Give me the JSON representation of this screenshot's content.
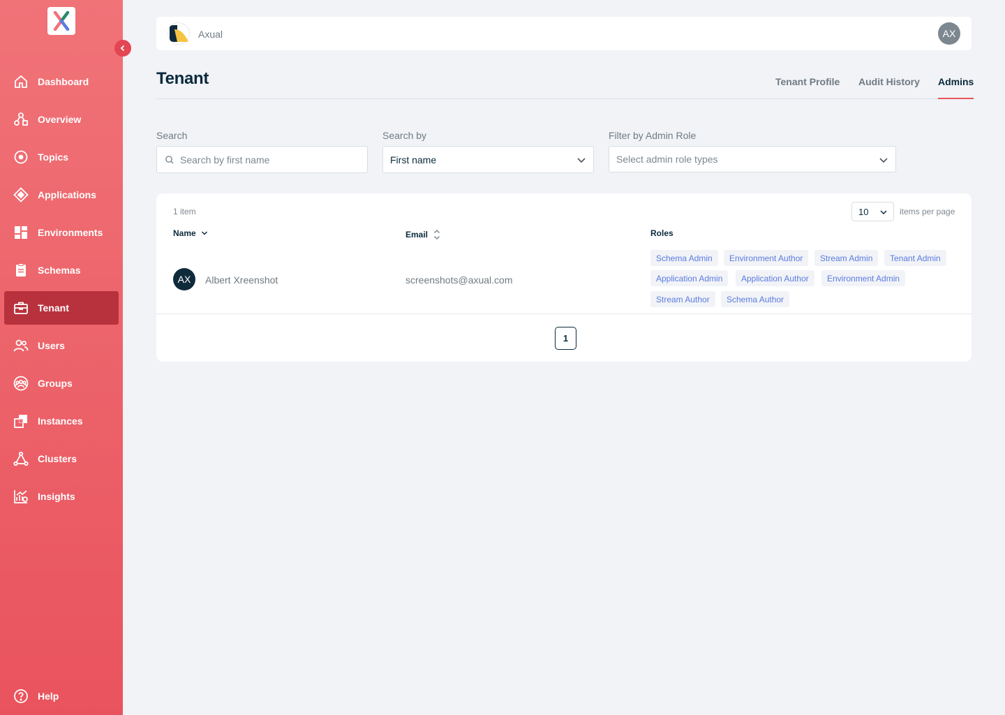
{
  "sidebar": {
    "items": [
      {
        "label": "Dashboard",
        "icon": "home-icon"
      },
      {
        "label": "Overview",
        "icon": "overview-icon"
      },
      {
        "label": "Topics",
        "icon": "topics-icon"
      },
      {
        "label": "Applications",
        "icon": "applications-icon"
      },
      {
        "label": "Environments",
        "icon": "environments-icon"
      },
      {
        "label": "Schemas",
        "icon": "schemas-icon"
      },
      {
        "label": "Tenant",
        "icon": "tenant-icon",
        "active": true
      },
      {
        "label": "Users",
        "icon": "users-icon"
      },
      {
        "label": "Groups",
        "icon": "groups-icon"
      },
      {
        "label": "Instances",
        "icon": "instances-icon"
      },
      {
        "label": "Clusters",
        "icon": "clusters-icon"
      },
      {
        "label": "Insights",
        "icon": "insights-icon"
      }
    ],
    "help_label": "Help"
  },
  "header": {
    "brand": "Axual",
    "user_initials": "AX"
  },
  "page": {
    "title": "Tenant",
    "tabs": [
      "Tenant Profile",
      "Audit History",
      "Admins"
    ],
    "active_tab": "Admins"
  },
  "filters": {
    "search_label": "Search",
    "search_placeholder": "Search by first name",
    "search_by_label": "Search by",
    "search_by_value": "First name",
    "role_label": "Filter by Admin Role",
    "role_placeholder": "Select admin role types"
  },
  "table": {
    "item_count": "1 item",
    "per_page_value": "10",
    "per_page_label": "items per page",
    "columns": [
      "Name",
      "Email",
      "Roles"
    ],
    "rows": [
      {
        "initials": "AX",
        "name": "Albert Xreenshot",
        "email": "screenshots@axual.com",
        "roles": [
          "Schema Admin",
          "Environment Author",
          "Stream Admin",
          "Tenant Admin",
          "Application Admin",
          "Application Author",
          "Environment Admin",
          "Stream Author",
          "Schema Author"
        ]
      }
    ],
    "current_page": "1"
  },
  "colors": {
    "sidebar_top": "#f07378",
    "sidebar_bottom": "#e9535d",
    "active_nav": "#b8323d",
    "accent": "#e9535d",
    "role_text": "#5b7be0"
  }
}
